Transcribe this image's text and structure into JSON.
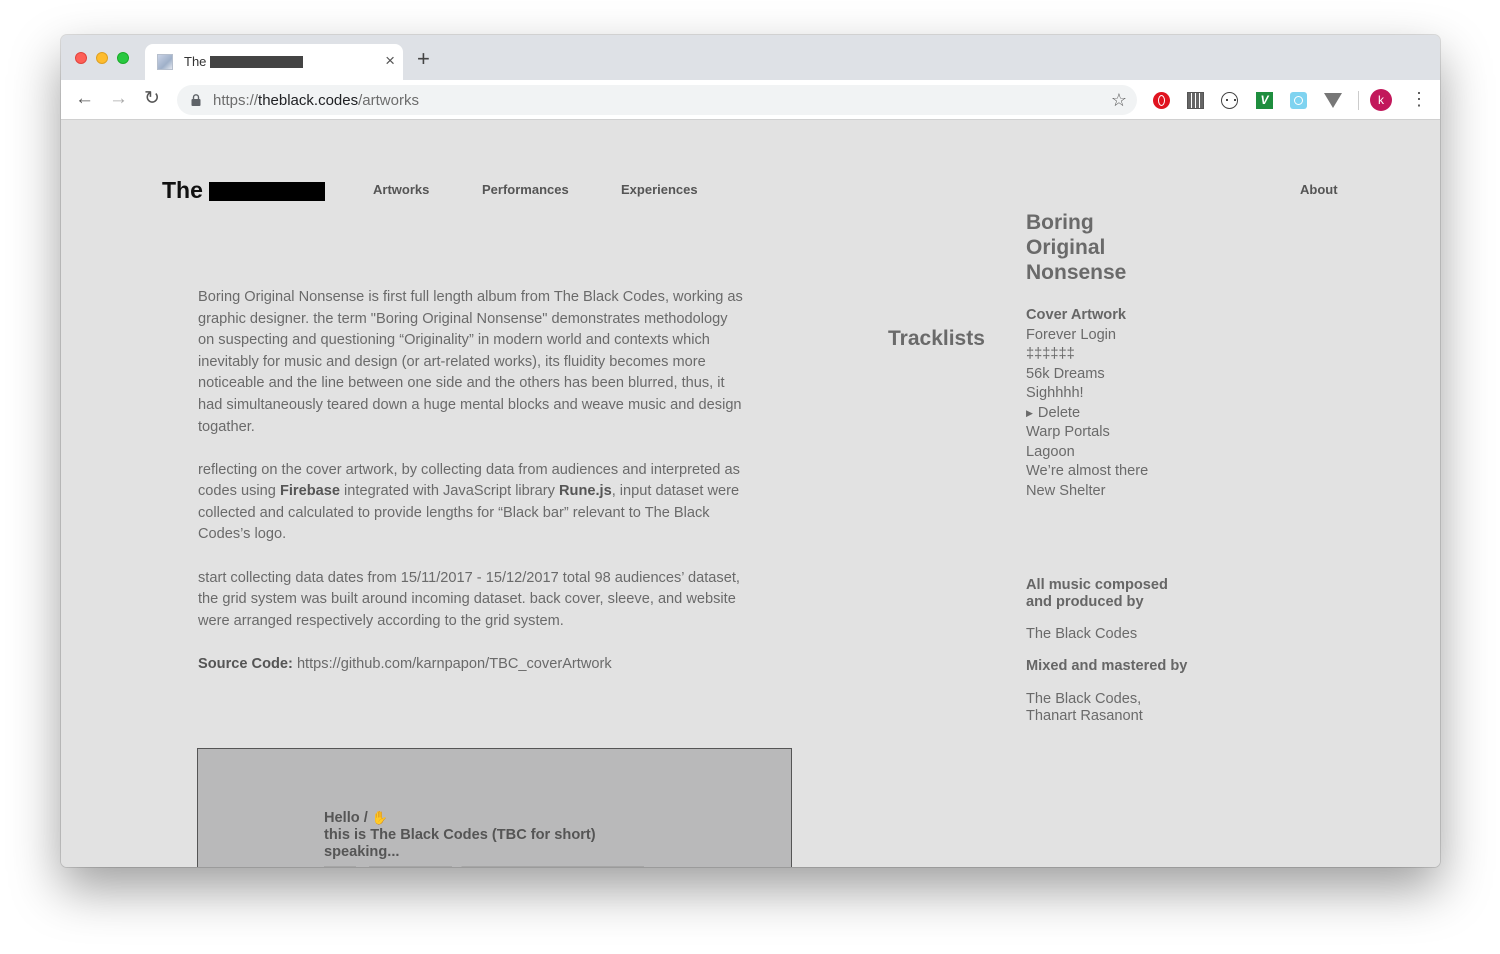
{
  "browser": {
    "tab_title": "The",
    "tab_close": "×",
    "new_tab": "+",
    "url_protocol": "https://",
    "url_host": "theblack.codes",
    "url_path": "/artworks",
    "avatar_initial": "k",
    "extensions": [
      "opera-icon",
      "grid-icon",
      "circle-code-icon",
      "v-extension-icon",
      "camera-icon",
      "vee-icon"
    ]
  },
  "site": {
    "logo_text": "The",
    "nav": {
      "artworks": "Artworks",
      "performances": "Performances",
      "experiences": "Experiences",
      "about": "About"
    }
  },
  "article": {
    "p1": "Boring Original Nonsense is first full length album from The Black Codes, working as graphic designer. the term \"Boring Original Nonsense\" demonstrates methodology on suspecting and questioning “Originality” in modern world and contexts which inevitably for music and design (or art-related works), its fluidity becomes more noticeable and the line between one side and the others has been blurred, thus, it had simultaneously teared down a huge mental blocks and weave music and design togather.",
    "p2_a": "reflecting on the cover artwork, by collecting data from audiences and interpreted as codes using ",
    "p2_firebase": "Firebase",
    "p2_b": " integrated with JavaScript library ",
    "p2_rune": "Rune.js",
    "p2_c": ", input dataset were collected and calculated to provide lengths for “Black bar” relevant to The Black Codes’s logo.",
    "p3": "start collecting data dates from 15/11/2017 - 15/12/2017 total 98 audiences’ dataset, the grid system was built around incoming dataset. back cover, sleeve, and website were arranged respectively according to the grid system.",
    "source_label": "Source Code:",
    "source_url": "https://github.com/karnpapon/TBC_coverArtwork"
  },
  "album": {
    "title_lines": [
      "Boring",
      "Original",
      "Nonsense"
    ],
    "tracklists_heading": "Tracklists",
    "cover_artwork": "Cover Artwork",
    "tracks": [
      "Forever Login",
      "‡‡‡‡‡‡",
      "56k Dreams",
      "Sighhhh!",
      "Delete",
      "Warp Portals",
      "Lagoon",
      "We’re almost there",
      "New Shelter"
    ],
    "credits": {
      "composed_label_1": "All music composed",
      "composed_label_2": "and produced by",
      "composed_value": "The Black Codes",
      "mixed_label": "Mixed and mastered by",
      "mixed_value_1": "The Black Codes,",
      "mixed_value_2": "Thanart Rasanont"
    }
  },
  "preview": {
    "line1": "Hello /",
    "hand": "✋",
    "line2": "this is The Black Codes (TBC for short)",
    "line3": "speaking..."
  }
}
